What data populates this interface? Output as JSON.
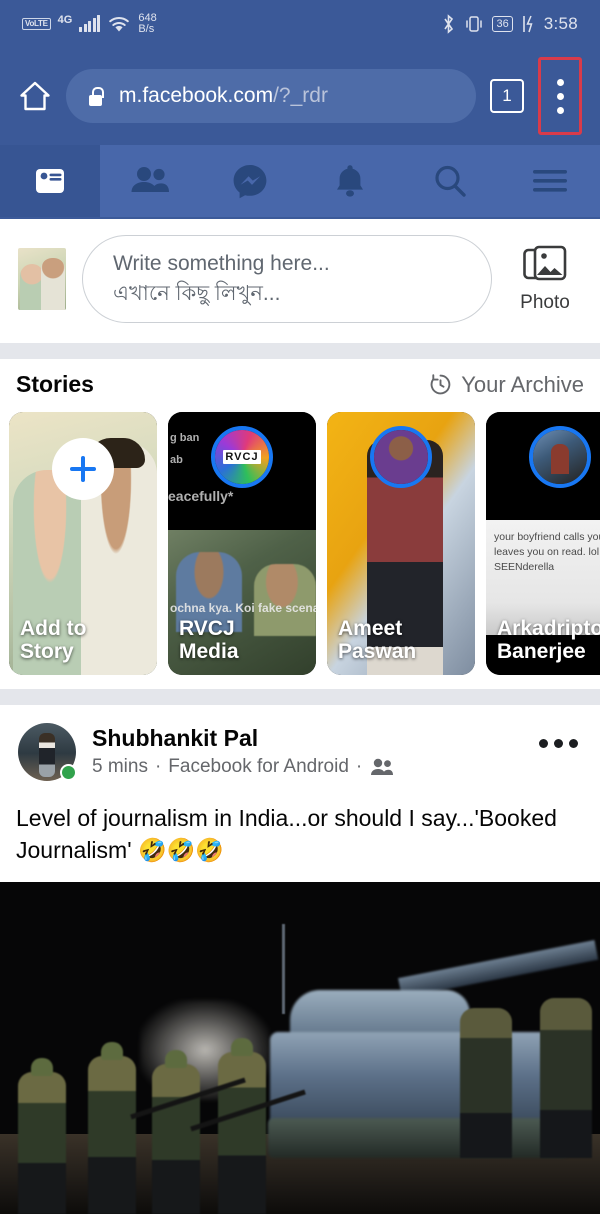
{
  "statusbar": {
    "volte": "VoLTE",
    "network": "4G",
    "speed_value": "648",
    "speed_unit": "B/s",
    "battery": "36",
    "time": "3:58",
    "bluetooth_icon": "bluetooth-icon",
    "vibrate_icon": "vibrate-icon",
    "charging_icon": "charging-icon",
    "wifi_icon": "wifi-icon",
    "signal_icon": "signal-bars-icon",
    "bg_color": "#3b5998"
  },
  "browser": {
    "home_icon": "home-icon",
    "lock_icon": "lock-icon",
    "url_main": "m.facebook.com",
    "url_suffix": "/?_rdr",
    "tab_count": "1",
    "menu_icon": "overflow-menu-icon",
    "highlight_color": "#d93b4a",
    "bg_color": "#3b5998"
  },
  "fbnav": {
    "bg_color": "#4867aa",
    "active_bg_color": "#375593",
    "icon_color": "#29487d",
    "items": [
      {
        "name": "newsfeed",
        "label": "News Feed",
        "icon": "newsfeed-icon",
        "active": true
      },
      {
        "name": "friends",
        "label": "Friend Requests",
        "icon": "friends-icon",
        "active": false
      },
      {
        "name": "messenger",
        "label": "Messenger",
        "icon": "messenger-icon",
        "active": false
      },
      {
        "name": "notifications",
        "label": "Notifications",
        "icon": "bell-icon",
        "active": false
      },
      {
        "name": "search",
        "label": "Search",
        "icon": "search-icon",
        "active": false
      },
      {
        "name": "menu",
        "label": "Menu",
        "icon": "hamburger-icon",
        "active": false
      }
    ]
  },
  "composer": {
    "avatar": "user-avatar",
    "placeholder_en": "Write something here...",
    "placeholder_bn": "এখানে কিছু লিখুন...",
    "photo_label": "Photo",
    "photo_icon": "photo-icon"
  },
  "stories": {
    "title": "Stories",
    "archive_label": "Your Archive",
    "archive_icon": "clock-history-icon",
    "cards": [
      {
        "name": "Add to\nStory",
        "line1": "Add to",
        "line2": "Story",
        "type": "add-story",
        "plus_icon": "plus-icon"
      },
      {
        "name": "RVCJ Media",
        "line1": "RVCJ",
        "line2": "Media",
        "type": "story",
        "overlay_top_1": "g ban",
        "overlay_top_2": "ab",
        "overlay_top_3": "eacefully*",
        "overlay_bottom": "ochna kya. Koi fake scenar",
        "avatar_text": "RVCJ"
      },
      {
        "name": "Ameet Paswan",
        "line1": "Ameet",
        "line2": "Paswan",
        "type": "story"
      },
      {
        "name": "Arkadripto Banerjee",
        "line1": "Arkadripto",
        "line2": "Banerjee",
        "type": "story",
        "text_line1": "your boyfriend calls you pri",
        "text_line2": "leaves you on read. lol ok",
        "text_line3": "SEENderella"
      }
    ]
  },
  "post": {
    "author": "Shubhankit Pal",
    "time": "5 mins",
    "separator1": "·",
    "source": "Facebook for Android",
    "separator2": "·",
    "audience_icon": "friends-audience-icon",
    "online_status": "online",
    "menu_icon": "post-options-icon",
    "body": "Level of journalism in India...or should I say...'Booked Journalism' 🤣🤣🤣",
    "image_alt": "military-tank-with-soldiers-photo"
  }
}
